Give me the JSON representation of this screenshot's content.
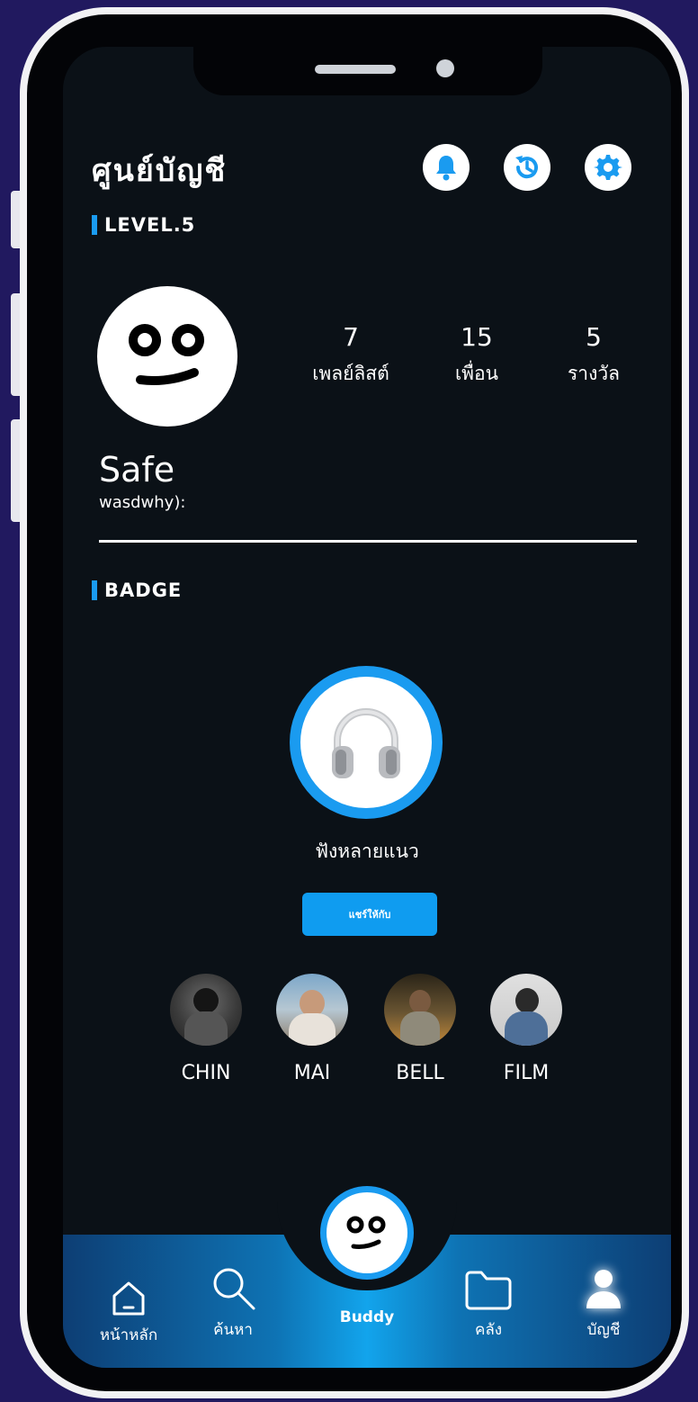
{
  "header": {
    "title": "ศูนย์บัญชี",
    "icons": [
      "bell-icon",
      "history-icon",
      "settings-icon"
    ]
  },
  "level": {
    "label": "LEVEL.5"
  },
  "profile": {
    "name": "Safe",
    "username": "wasdwhy):",
    "stats": [
      {
        "value": "7",
        "label": "เพลย์ลิสต์"
      },
      {
        "value": "15",
        "label": "เพื่อน"
      },
      {
        "value": "5",
        "label": "รางวัล"
      }
    ]
  },
  "badge": {
    "section_label": "BADGE",
    "icon": "headphones-icon",
    "name": "ฟังหลายแนว",
    "share_label": "แชร์ให้กับ"
  },
  "friends": [
    {
      "name": "CHIN"
    },
    {
      "name": "MAI"
    },
    {
      "name": "BELL"
    },
    {
      "name": "FILM"
    }
  ],
  "nav": {
    "items": [
      {
        "label": "หน้าหลัก",
        "icon": "home-icon"
      },
      {
        "label": "ค้นหา",
        "icon": "search-icon"
      },
      {
        "label": "Buddy",
        "icon": "buddy-face-icon"
      },
      {
        "label": "คลัง",
        "icon": "folder-icon"
      },
      {
        "label": "บัญชี",
        "icon": "user-icon",
        "active": true
      }
    ]
  },
  "colors": {
    "accent": "#1a9bf0",
    "background": "#21195f",
    "screen": "#0b1117"
  }
}
